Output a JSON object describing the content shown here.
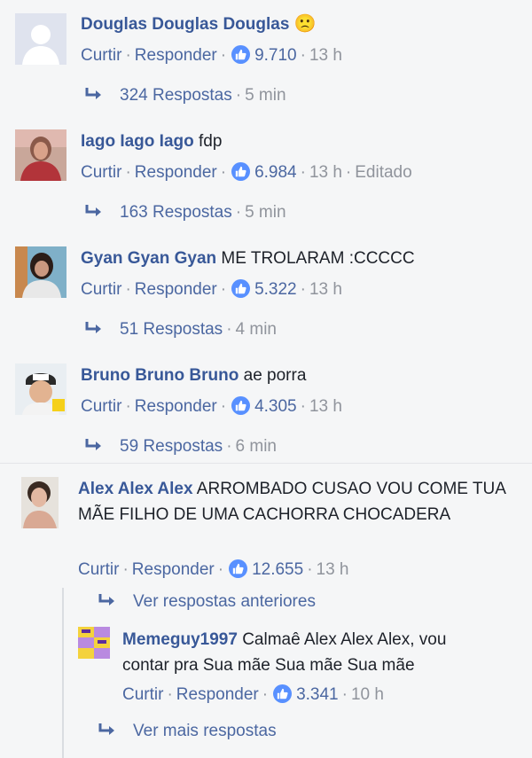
{
  "comments": [
    {
      "name": "Douglas Douglas Douglas",
      "text": "",
      "emoji": "🙁",
      "actions": {
        "like": "Curtir",
        "reply": "Responder",
        "likes": "9.710",
        "time": "13 h",
        "edited": ""
      },
      "replies": {
        "label": "324 Respostas",
        "time": "5 min"
      }
    },
    {
      "name": "Iago Iago Iago",
      "text": "fdp",
      "actions": {
        "like": "Curtir",
        "reply": "Responder",
        "likes": "6.984",
        "time": "13 h",
        "edited": "Editado"
      },
      "replies": {
        "label": "163 Respostas",
        "time": "5 min"
      }
    },
    {
      "name": "Gyan Gyan Gyan",
      "text": "ME TROLARAM :CCCCC",
      "actions": {
        "like": "Curtir",
        "reply": "Responder",
        "likes": "5.322",
        "time": "13 h",
        "edited": ""
      },
      "replies": {
        "label": "51 Respostas",
        "time": "4 min"
      }
    },
    {
      "name": "Bruno Bruno Bruno",
      "text": "ae porra",
      "actions": {
        "like": "Curtir",
        "reply": "Responder",
        "likes": "4.305",
        "time": "13 h",
        "edited": ""
      },
      "replies": {
        "label": "59 Respostas",
        "time": "6 min"
      }
    },
    {
      "name": "Alex Alex Alex",
      "text": "ARROMBADO CUSAO VOU COME TUA MÃE FILHO DE UMA CACHORRA CHOCADERA",
      "actions": {
        "like": "Curtir",
        "reply": "Responder",
        "likes": "12.655",
        "time": "13 h",
        "edited": ""
      },
      "previous_replies": "Ver respostas anteriores",
      "reply": {
        "name": "Memeguy1997",
        "text": "Calmaê Alex Alex Alex, vou contar pra Sua mãe Sua mãe Sua mãe",
        "actions": {
          "like": "Curtir",
          "reply": "Responder",
          "likes": "3.341",
          "time": "10 h"
        }
      },
      "more_replies": "Ver mais respostas"
    }
  ],
  "colors": {
    "name": "#385898",
    "link": "#4b67a1",
    "meta": "#90949c",
    "like": "#5890ff",
    "background": "#f5f6f7"
  },
  "icons": {
    "like": "thumbs-up-icon",
    "reply": "reply-arrow-icon",
    "avatar": "profile-avatar-icon"
  }
}
